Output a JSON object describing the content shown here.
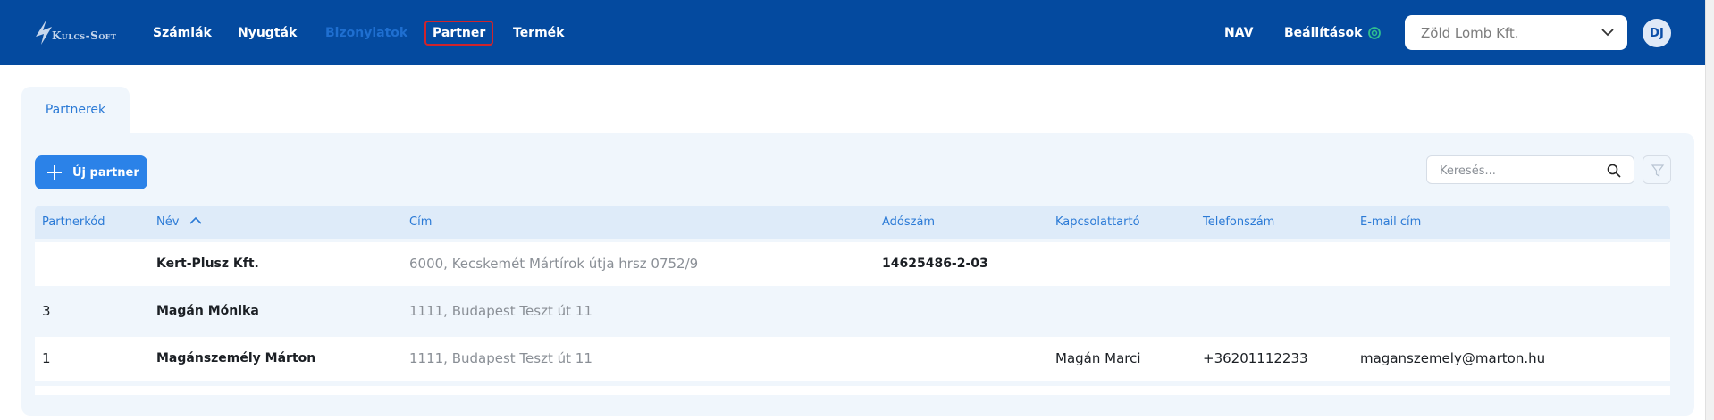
{
  "app": {
    "logo_text": "Kulcs-Soft"
  },
  "nav": {
    "items": [
      {
        "label": "Számlák"
      },
      {
        "label": "Nyugták"
      },
      {
        "label": "Bizonylatok"
      },
      {
        "label": "Partner"
      },
      {
        "label": "Termék"
      }
    ],
    "right": {
      "nav_label": "NAV",
      "settings_label": "Beállítások"
    }
  },
  "company_select": {
    "value": "Zöld Lomb Kft."
  },
  "user": {
    "initials": "DJ"
  },
  "tab": {
    "label": "Partnerek"
  },
  "toolbar": {
    "new_partner_label": "Új partner",
    "search_placeholder": "Keresés..."
  },
  "table": {
    "columns": [
      "Partnerkód",
      "Név",
      "Cím",
      "Adószám",
      "Kapcsolattartó",
      "Telefonszám",
      "E-mail cím"
    ],
    "sorted_column": "Név",
    "sort_direction": "ascending",
    "rows": [
      {
        "code": "",
        "name": "Kert-Plusz Kft.",
        "address": "6000, Kecskemét Mártírok útja hrsz 0752/9",
        "tax": "14625486-2-03",
        "contact": "",
        "phone": "",
        "email": ""
      },
      {
        "code": "3",
        "name": "Magán Mónika",
        "address": "1111, Budapest Teszt út 11",
        "tax": "",
        "contact": "",
        "phone": "",
        "email": ""
      },
      {
        "code": "1",
        "name": "Magánszemély Márton",
        "address": "1111, Budapest Teszt út 11",
        "tax": "",
        "contact": "Magán Marci",
        "phone": "+36201112233",
        "email": "maganszemely@marton.hu"
      }
    ]
  },
  "colors": {
    "header_bg": "#044a9f",
    "accent": "#2b82e8",
    "highlight_border": "#d0242c"
  }
}
